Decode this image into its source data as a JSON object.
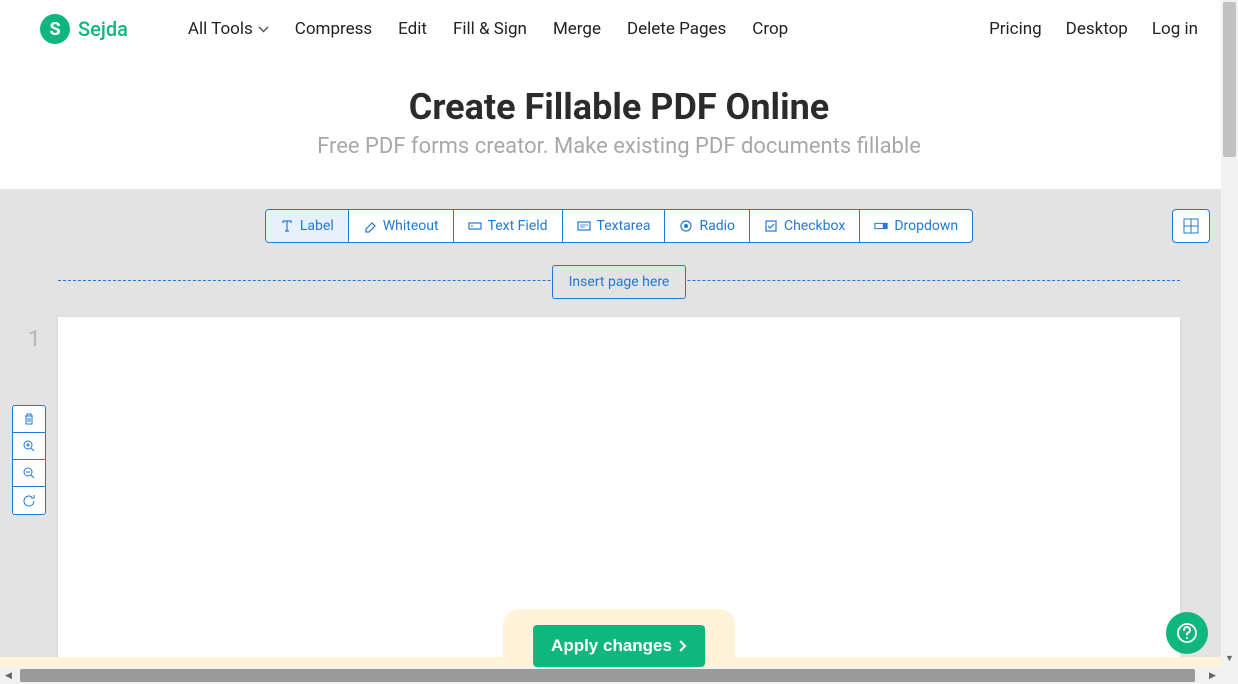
{
  "brand": {
    "letter": "S",
    "name": "Sejda"
  },
  "nav": {
    "all_tools": "All Tools",
    "compress": "Compress",
    "edit": "Edit",
    "fill_sign": "Fill & Sign",
    "merge": "Merge",
    "delete_pages": "Delete Pages",
    "crop": "Crop",
    "pricing": "Pricing",
    "desktop": "Desktop",
    "login": "Log in"
  },
  "hero": {
    "title": "Create Fillable PDF Online",
    "subtitle": "Free PDF forms creator. Make existing PDF documents fillable"
  },
  "tools": {
    "label": "Label",
    "whiteout": "Whiteout",
    "text_field": "Text Field",
    "textarea": "Textarea",
    "radio": "Radio",
    "checkbox": "Checkbox",
    "dropdown": "Dropdown"
  },
  "editor": {
    "insert_page": "Insert page here",
    "page_number": "1",
    "apply": "Apply changes"
  },
  "colors": {
    "brand_green": "#0fb77e",
    "accent_blue": "#2079d6"
  }
}
